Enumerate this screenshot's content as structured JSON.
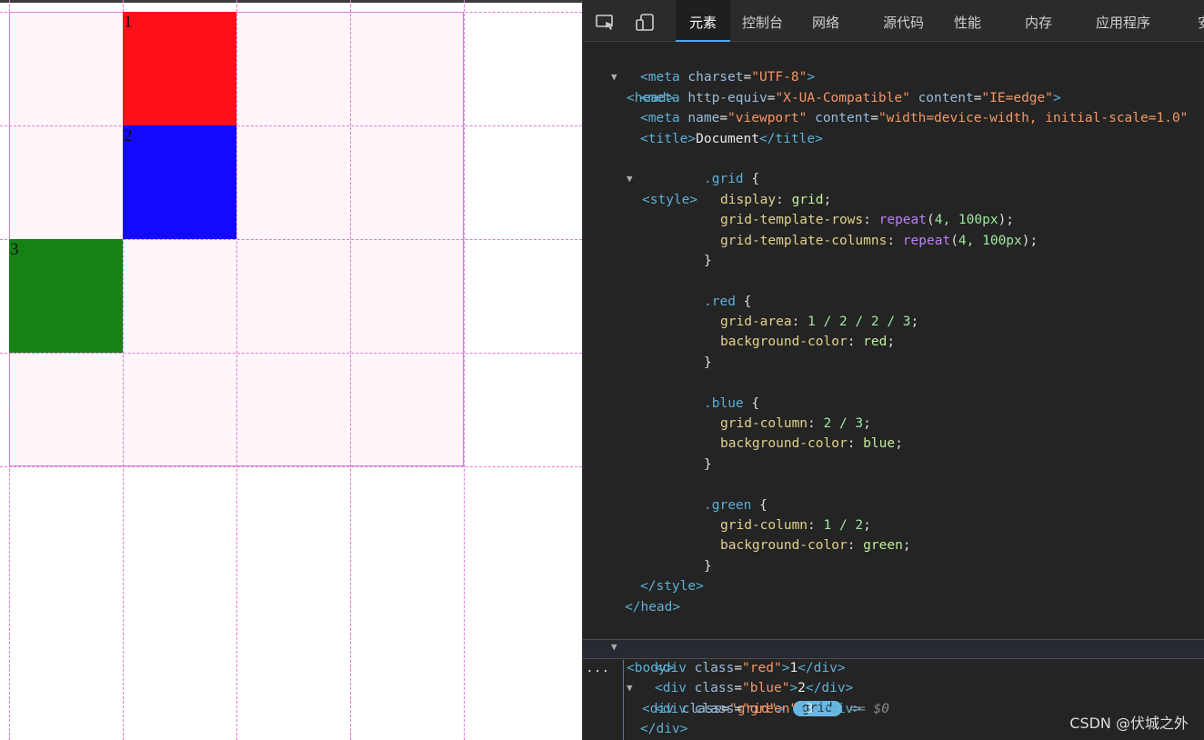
{
  "viewport": {
    "cells": [
      {
        "label": "1",
        "color": "#ff0f1a"
      },
      {
        "label": "2",
        "color": "#1409ff"
      },
      {
        "label": "3",
        "color": "#168216"
      }
    ]
  },
  "devtools": {
    "tabs": [
      "元素",
      "控制台",
      "网络",
      "源代码",
      "性能",
      "内存",
      "应用程序",
      "安"
    ],
    "active_tab": "元素",
    "icons": [
      "inspect-element-icon",
      "device-toolbar-icon"
    ],
    "code": {
      "head_open": "<head>",
      "meta1": {
        "attr": "charset",
        "val": "\"UTF-8\""
      },
      "meta2": {
        "attr1": "http-equiv",
        "val1": "\"X-UA-Compatible\"",
        "attr2": "content",
        "val2": "\"IE=edge\""
      },
      "meta3": {
        "attr1": "name",
        "val1": "\"viewport\"",
        "attr2": "content",
        "val2": "\"width=device-width, initial-scale=1.0\""
      },
      "title_text": "Document",
      "style_open": "<style>",
      "grid_selector": ".grid",
      "grid_display": "grid",
      "grid_rows_fn": "repeat",
      "grid_rows_args": "4, 100px",
      "grid_cols_fn": "repeat",
      "grid_cols_args": "4, 100px",
      "red_selector": ".red",
      "red_area": "1 / 2 / 2 / 3",
      "red_bg": "red",
      "blue_selector": ".blue",
      "blue_col": "2 / 3",
      "blue_bg": "blue",
      "green_selector": ".green",
      "green_col": "1 / 2",
      "green_bg": "green",
      "style_close": "</style>",
      "head_close": "</head>",
      "body_open": "<body>",
      "div_grid_class": "\"grid\"",
      "grid_badge": "grid",
      "eq_ref": "== $0",
      "div_red_class": "\"red\"",
      "div_red_text": "1",
      "div_blue_class": "\"blue\"",
      "div_blue_text": "2",
      "div_green_class": "\"green\"",
      "div_green_text": "3",
      "div_close": "</div>",
      "ellipsis": "..."
    }
  },
  "watermark": "CSDN @伏城之外"
}
